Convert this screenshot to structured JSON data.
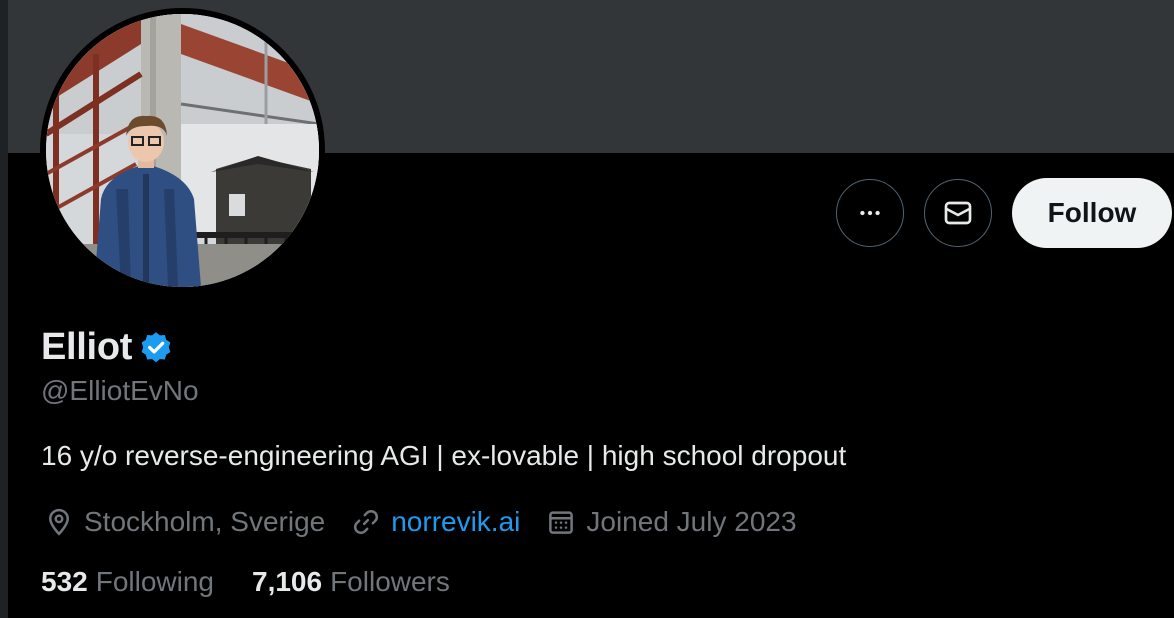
{
  "profile": {
    "display_name": "Elliot",
    "handle": "@ElliotEvNo",
    "bio": "16 y/o reverse-engineering AGI | ex-lovable | high school dropout",
    "location": "Stockholm, Sverige",
    "website": "norrevik.ai",
    "joined": "Joined July 2023",
    "following_count": "532",
    "following_label": "Following",
    "followers_count": "7,106",
    "followers_label": "Followers"
  },
  "actions": {
    "follow_label": "Follow"
  },
  "icons": {
    "more": "more-horizontal-icon",
    "message": "envelope-icon",
    "verified": "verified-badge-icon",
    "location": "location-pin-icon",
    "link": "link-icon",
    "calendar": "calendar-icon"
  },
  "colors": {
    "background": "#000000",
    "banner": "#333639",
    "primary_text": "#e7e9ea",
    "secondary_text": "#71767b",
    "link": "#1d9bf0",
    "verified": "#1d9bf0",
    "follow_button_bg": "#eff3f4"
  }
}
